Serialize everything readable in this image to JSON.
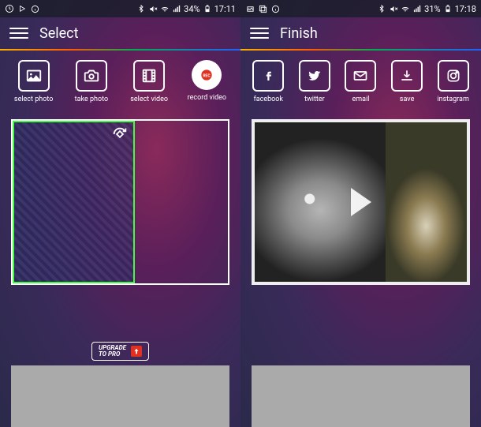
{
  "left": {
    "status": {
      "battery": "34%",
      "time": "17:11"
    },
    "title": "Select",
    "actions": [
      {
        "key": "select-photo",
        "label": "select photo"
      },
      {
        "key": "take-photo",
        "label": "take photo"
      },
      {
        "key": "select-video",
        "label": "select video"
      },
      {
        "key": "record-video",
        "label": "record video"
      }
    ],
    "upgrade": {
      "line1": "UPGRADE",
      "line2": "TO PRO"
    }
  },
  "right": {
    "status": {
      "battery": "31%",
      "time": "17:18"
    },
    "title": "Finish",
    "actions": [
      {
        "key": "facebook",
        "label": "facebook"
      },
      {
        "key": "twitter",
        "label": "twitter"
      },
      {
        "key": "email",
        "label": "email"
      },
      {
        "key": "save",
        "label": "save"
      },
      {
        "key": "instagram",
        "label": "instagram"
      }
    ]
  }
}
